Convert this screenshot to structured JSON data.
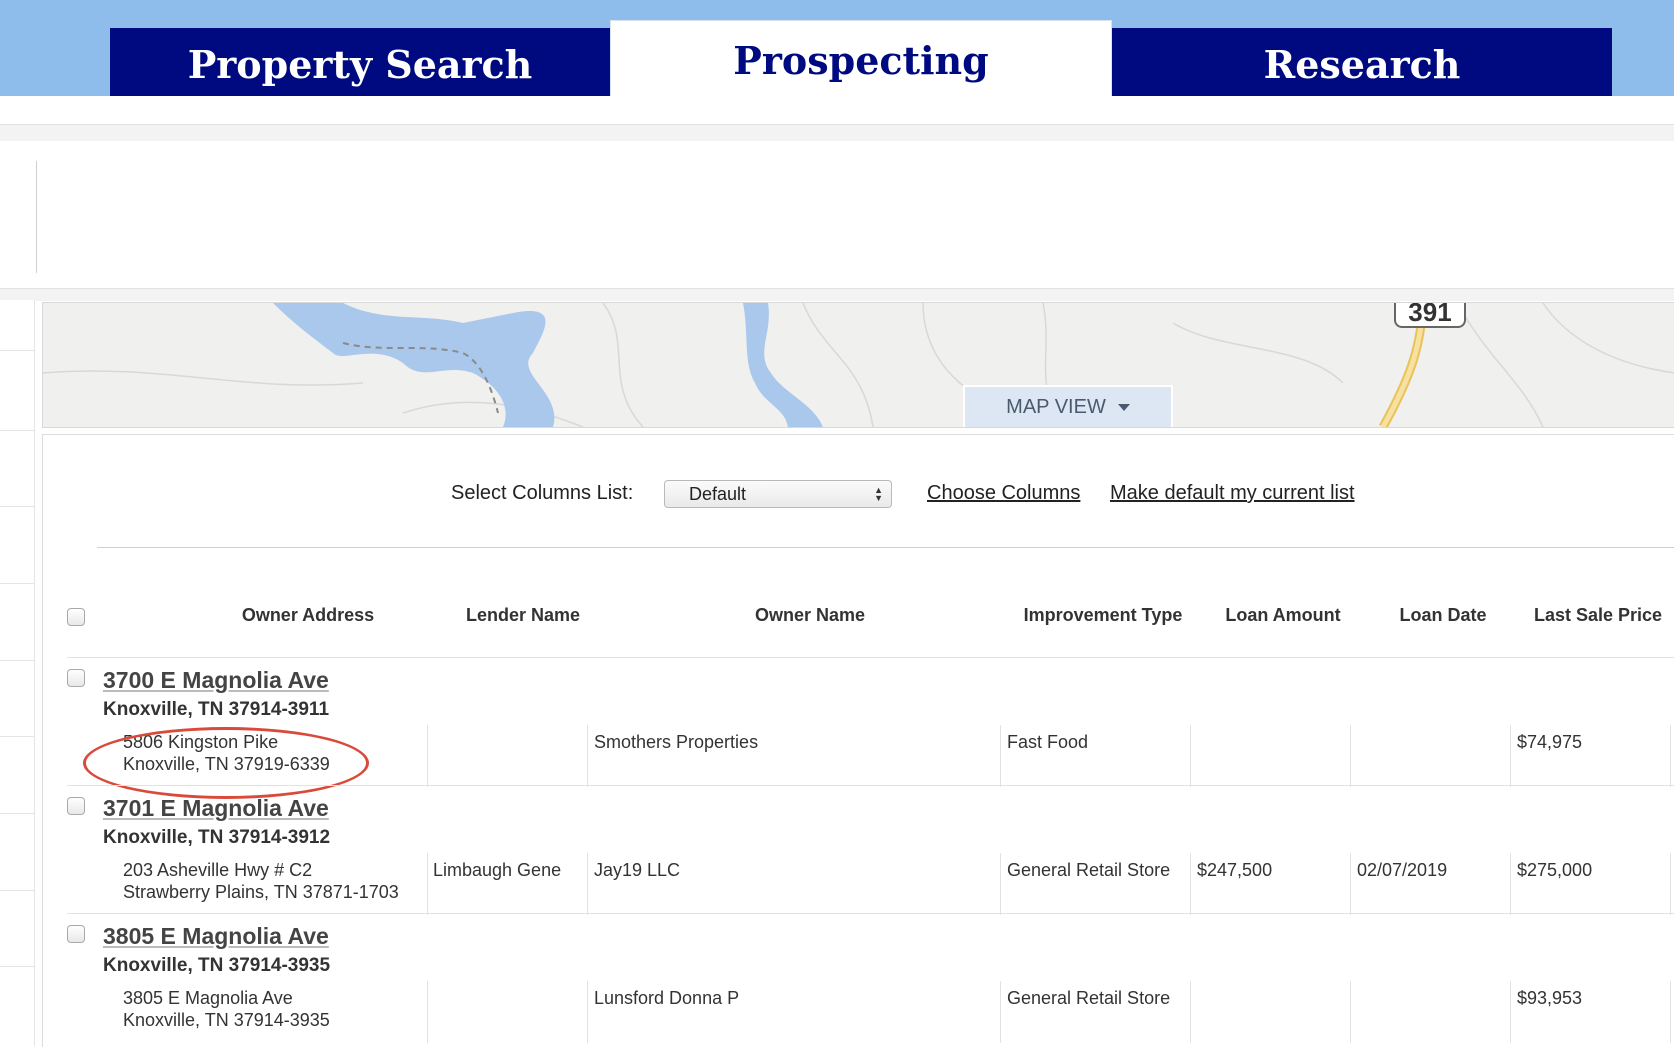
{
  "tabs": [
    {
      "label": "Property Search"
    },
    {
      "label": "Prospecting"
    },
    {
      "label": "Research"
    }
  ],
  "active_tab": "Prospecting",
  "map": {
    "view_button": "MAP VIEW",
    "road_shield": "391"
  },
  "columns_bar": {
    "label": "Select Columns List:",
    "selected": "Default",
    "choose_columns": "Choose Columns",
    "make_default": "Make default my current list"
  },
  "table": {
    "headers": [
      "Owner Address",
      "Lender Name",
      "Owner Name",
      "Improvement Type",
      "Loan Amount",
      "Loan Date",
      "Last Sale Price"
    ],
    "rows": [
      {
        "address": "3700 E Magnolia Ave",
        "city": "Knoxville, TN 37914-3911",
        "owner_address_1": "5806 Kingston Pike",
        "owner_address_2": "Knoxville, TN 37919-6339",
        "lender": "",
        "owner": "Smothers Properties",
        "improvement": "Fast Food",
        "loan_amount": "",
        "loan_date": "",
        "last_sale": "$74,975",
        "highlighted": true
      },
      {
        "address": "3701 E Magnolia Ave",
        "city": "Knoxville, TN 37914-3912",
        "owner_address_1": "203 Asheville Hwy # C2",
        "owner_address_2": "Strawberry Plains, TN 37871-1703",
        "lender": "Limbaugh Gene",
        "owner": "Jay19 LLC",
        "improvement": "General Retail Store",
        "loan_amount": "$247,500",
        "loan_date": "02/07/2019",
        "last_sale": "$275,000",
        "highlighted": false
      },
      {
        "address": "3805 E Magnolia Ave",
        "city": "Knoxville, TN 37914-3935",
        "owner_address_1": "3805 E Magnolia Ave",
        "owner_address_2": "Knoxville, TN 37914-3935",
        "lender": "",
        "owner": "Lunsford Donna P",
        "improvement": "General Retail Store",
        "loan_amount": "",
        "loan_date": "",
        "last_sale": "$93,953",
        "highlighted": false
      }
    ]
  },
  "colors": {
    "tab_bg": "#000a80",
    "top_band": "#8fbdeb",
    "highlight_circle": "#d94a3a",
    "water": "#a9c8ec",
    "road": "#f2d27a"
  }
}
